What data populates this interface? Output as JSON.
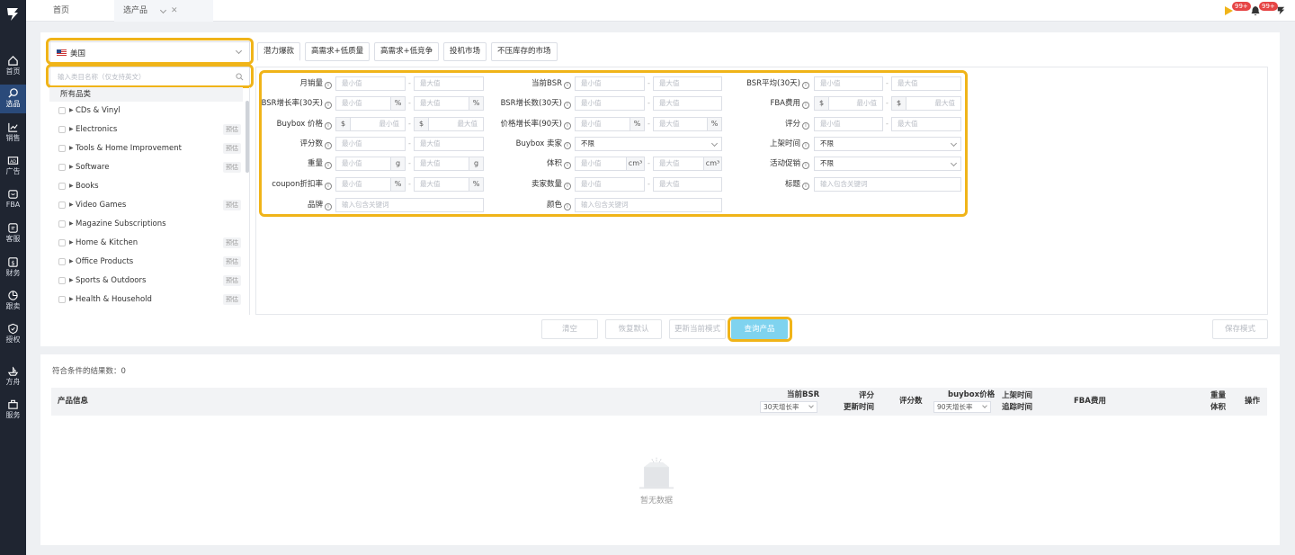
{
  "tabs": [
    {
      "label": "首页"
    },
    {
      "label": "选产品"
    }
  ],
  "notifications": {
    "badge_1": "99+",
    "badge_2": "99+"
  },
  "sidebar": {
    "items": [
      {
        "label": "首页",
        "icon": "home-icon"
      },
      {
        "label": "选品",
        "icon": "search-icon",
        "active": true
      },
      {
        "label": "销售",
        "icon": "chart-icon"
      },
      {
        "label": "广告",
        "icon": "ad-icon"
      },
      {
        "label": "FBA",
        "icon": "box-icon"
      },
      {
        "label": "客服",
        "icon": "chat-icon"
      },
      {
        "label": "财务",
        "icon": "money-icon"
      },
      {
        "label": "跟卖",
        "icon": "pie-icon"
      },
      {
        "label": "授权",
        "icon": "shield-icon"
      },
      {
        "label": "方舟",
        "icon": "ark-icon"
      },
      {
        "label": "服务",
        "icon": "service-icon"
      }
    ]
  },
  "country": {
    "selected": "美国"
  },
  "category_search": {
    "placeholder": "输入类目名称（仅支持英文）"
  },
  "category_list": {
    "header": "所有品类",
    "items": [
      {
        "name": "CDs & Vinyl",
        "tag": ""
      },
      {
        "name": "Electronics",
        "tag": "预估"
      },
      {
        "name": "Tools & Home Improvement",
        "tag": "预估"
      },
      {
        "name": "Software",
        "tag": "预估"
      },
      {
        "name": "Books",
        "tag": ""
      },
      {
        "name": "Video Games",
        "tag": "预估"
      },
      {
        "name": "Magazine Subscriptions",
        "tag": ""
      },
      {
        "name": "Home & Kitchen",
        "tag": "预估"
      },
      {
        "name": "Office Products",
        "tag": "预估"
      },
      {
        "name": "Sports & Outdoors",
        "tag": "预估"
      },
      {
        "name": "Health & Household",
        "tag": "预估"
      }
    ]
  },
  "presets": [
    "潜力爆款",
    "高需求+低质量",
    "高需求+低竞争",
    "投机市场",
    "不压库存的市场"
  ],
  "filters": {
    "monthly_sales": "月销量",
    "current_bsr": "当前BSR",
    "bsr_avg_30": "BSR平均(30天)",
    "bsr_growth_rate_30": "BSR增长率(30天)",
    "bsr_growth_count_30": "BSR增长数(30天)",
    "fba_fee": "FBA费用",
    "buybox_price": "Buybox 价格",
    "price_growth_90": "价格增长率(90天)",
    "rating": "评分",
    "rating_count": "评分数",
    "buybox_seller": "Buybox 卖家",
    "listing_time": "上架时间",
    "weight": "重量",
    "volume": "体积",
    "promotion": "活动促销",
    "coupon_rate": "coupon折扣率",
    "seller_count": "卖家数量",
    "title": "标题",
    "brand": "品牌",
    "color": "颜色",
    "min_ph": "最小值",
    "max_ph": "最大值",
    "keyword_ph": "输入包含关键词",
    "any": "不限",
    "unit_pct": "%",
    "unit_usd": "$",
    "unit_g": "g",
    "unit_cm3": "cm³",
    "info": "i",
    "dash": "-"
  },
  "actions": {
    "clear": "清空",
    "reset": "恢复默认",
    "update_mode": "更新当前模式",
    "search": "查询产品",
    "save_mode": "保存模式"
  },
  "results": {
    "count_label": "符合条件的结果数：",
    "count": "0",
    "empty_text": "暂无数据"
  },
  "table": {
    "product_info": "产品信息",
    "current_bsr": "当前BSR",
    "bsr_sort": "30天增长率",
    "rating": "评分",
    "update_time": "更新时间",
    "rating_count": "评分数",
    "buybox_price": "buybox价格",
    "price_sort": "90天增长率",
    "listing_time": "上架时间",
    "track_time": "追踪时间",
    "fba_fee": "FBA费用",
    "weight": "重量",
    "volume": "体积",
    "actions": "操作"
  }
}
